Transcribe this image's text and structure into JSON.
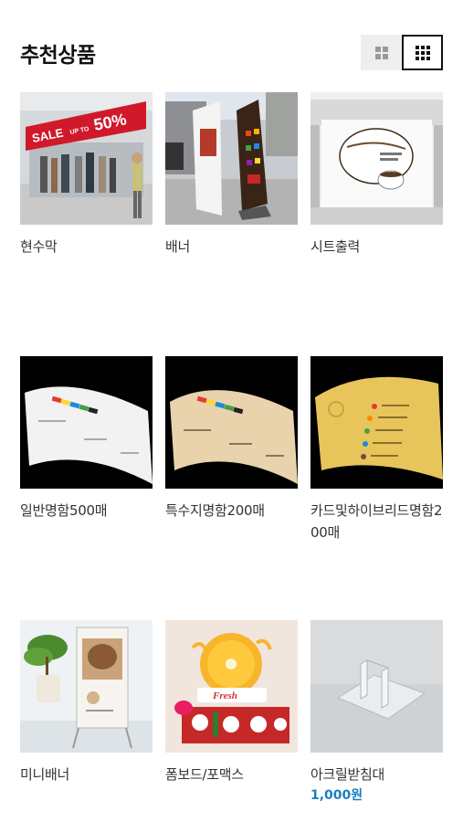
{
  "section": {
    "title": "추천상품"
  },
  "view_toggle": {
    "grid2": "grid-2-icon",
    "grid3": "grid-3-icon"
  },
  "products": [
    {
      "name": "현수막",
      "sign_sale": "SALE",
      "sign_upto": "UP TO",
      "sign_pct": "50%"
    },
    {
      "name": "배너"
    },
    {
      "name": "시트출력"
    },
    {
      "name": "일반명함500매"
    },
    {
      "name": "특수지명함200매"
    },
    {
      "name": "카드및하이브리드명함200매"
    },
    {
      "name": "미니배너"
    },
    {
      "name": "폼보드/포맥스",
      "sign_fresh": "Fresh"
    },
    {
      "name": "아크릴받침대",
      "price": "1,000원"
    }
  ]
}
